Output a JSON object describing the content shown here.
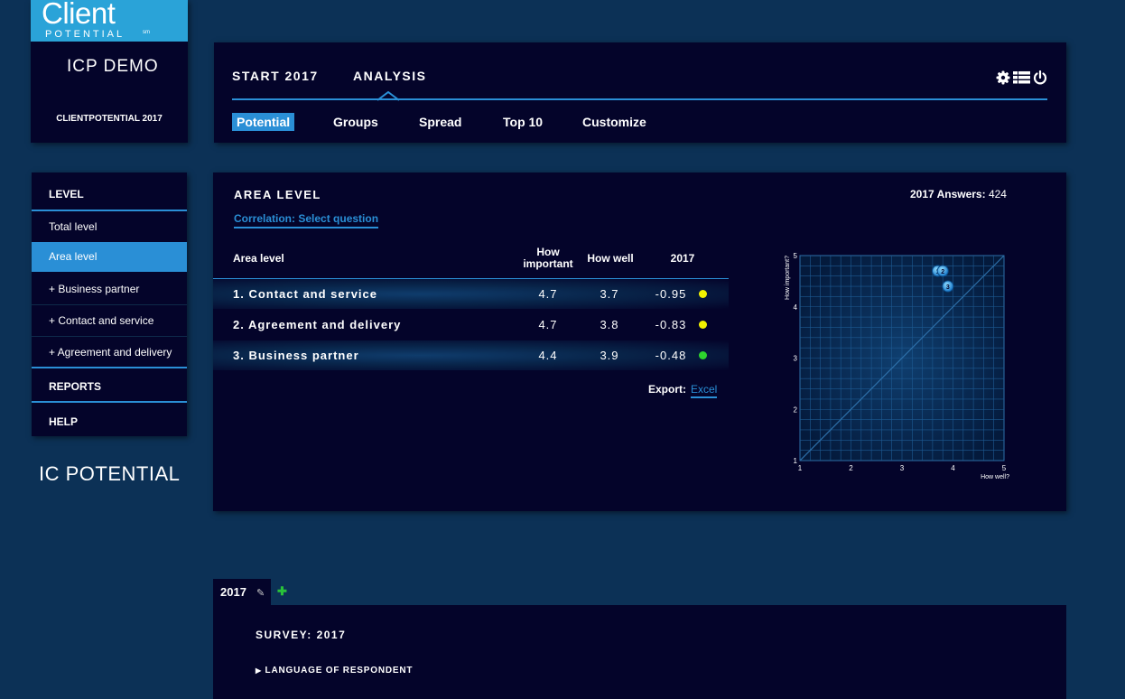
{
  "brand": {
    "logo_client": "Client",
    "logo_potential": "POTENTIAL",
    "logo_sm": "sm",
    "demo": "ICP DEMO",
    "company": "CLIENTPOTENTIAL 2017",
    "bottom_logo": "IC POTENTIAL"
  },
  "nav": {
    "main_tabs": [
      "START 2017",
      "ANALYSIS"
    ],
    "active_main": "ANALYSIS",
    "sub_tabs": [
      "Potential",
      "Groups",
      "Spread",
      "Top 10",
      "Customize"
    ],
    "active_sub": "Potential",
    "icons": [
      "gear-icon",
      "list-icon",
      "power-icon"
    ]
  },
  "sidebar": {
    "level_header": "LEVEL",
    "items": [
      "Total level",
      "Area level",
      "+ Business partner",
      "+ Contact and service",
      "+ Agreement and delivery"
    ],
    "active_item": "Area level",
    "reports_header": "REPORTS",
    "help_header": "HELP"
  },
  "main": {
    "title": "AREA LEVEL",
    "answers_label": "2017 Answers:",
    "answers_value": "424",
    "correlation_link": "Correlation: Select question",
    "table": {
      "headers": [
        "Area level",
        "How important",
        "How well",
        "2017"
      ],
      "rows": [
        {
          "name": "1. Contact and service",
          "important": "4.7",
          "well": "3.7",
          "score": "-0.95",
          "status": "yellow"
        },
        {
          "name": "2. Agreement and delivery",
          "important": "4.7",
          "well": "3.8",
          "score": "-0.83",
          "status": "yellow"
        },
        {
          "name": "3. Business partner",
          "important": "4.4",
          "well": "3.9",
          "score": "-0.48",
          "status": "green"
        }
      ]
    },
    "export_label": "Export:",
    "export_link": "Excel"
  },
  "colors": {
    "accent": "#2a8fd6",
    "yellow": "#f2f200",
    "green": "#2dd42d",
    "panel": "#04042a",
    "background": "#0c3156"
  },
  "chart_data": {
    "type": "scatter",
    "xlabel": "How well?",
    "ylabel": "How important?",
    "xlim": [
      1,
      5
    ],
    "ylim": [
      1,
      5
    ],
    "x_ticks": [
      1,
      2,
      3,
      4,
      5
    ],
    "y_ticks": [
      1,
      2,
      3,
      4,
      5
    ],
    "grid": true,
    "diagonal": true,
    "points": [
      {
        "label": "1",
        "x": 3.7,
        "y": 4.7
      },
      {
        "label": "2",
        "x": 3.8,
        "y": 4.7
      },
      {
        "label": "3",
        "x": 3.9,
        "y": 4.4
      }
    ]
  },
  "survey": {
    "year_tab": "2017",
    "title": "SURVEY: 2017",
    "language_row": "LANGUAGE OF RESPONDENT"
  }
}
